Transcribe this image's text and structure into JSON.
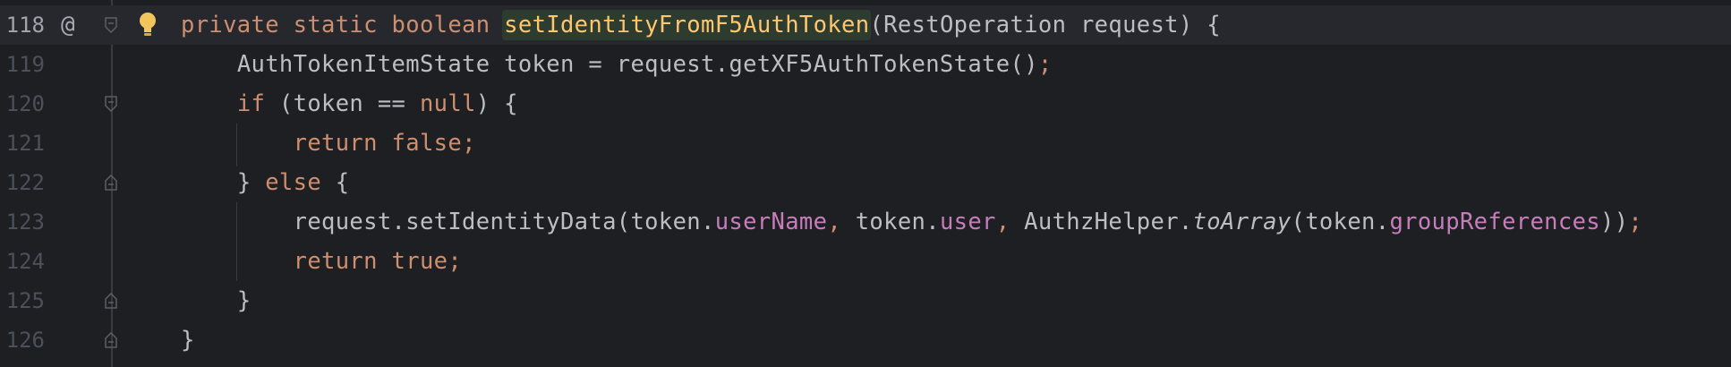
{
  "editor": {
    "gutter": {
      "override_marker": "@",
      "intention_bulb": "lightbulb-icon"
    },
    "lines": [
      {
        "number": "118",
        "indent": "",
        "tokens": [
          {
            "t": "private",
            "c": "kw"
          },
          {
            "t": " "
          },
          {
            "t": "static",
            "c": "kw"
          },
          {
            "t": " "
          },
          {
            "t": "boolean",
            "c": "kw"
          },
          {
            "t": " "
          },
          {
            "t": "setIdentityFromF5AuthToken",
            "c": "fn-decl"
          },
          {
            "t": "(RestOperation request) {"
          }
        ]
      },
      {
        "number": "119",
        "indent": "    ",
        "tokens": [
          {
            "t": "AuthTokenItemState token = request.getXF5AuthTokenState()"
          },
          {
            "t": ";",
            "c": "semi"
          }
        ]
      },
      {
        "number": "120",
        "indent": "    ",
        "tokens": [
          {
            "t": "if",
            "c": "kw"
          },
          {
            "t": " (token == "
          },
          {
            "t": "null",
            "c": "kw"
          },
          {
            "t": ") {"
          }
        ]
      },
      {
        "number": "121",
        "indent": "        ",
        "tokens": [
          {
            "t": "return",
            "c": "kw"
          },
          {
            "t": " "
          },
          {
            "t": "false",
            "c": "kw"
          },
          {
            "t": ";",
            "c": "semi"
          }
        ]
      },
      {
        "number": "122",
        "indent": "    ",
        "tokens": [
          {
            "t": "} "
          },
          {
            "t": "else",
            "c": "kw"
          },
          {
            "t": " {"
          }
        ]
      },
      {
        "number": "123",
        "indent": "        ",
        "tokens": [
          {
            "t": "request.setIdentityData(token."
          },
          {
            "t": "userName",
            "c": "field"
          },
          {
            "t": ",",
            "c": "semi"
          },
          {
            "t": " token."
          },
          {
            "t": "user",
            "c": "field"
          },
          {
            "t": ",",
            "c": "semi"
          },
          {
            "t": " AuthzHelper."
          },
          {
            "t": "toArray",
            "c": "static-call"
          },
          {
            "t": "(token."
          },
          {
            "t": "groupReferences",
            "c": "field"
          },
          {
            "t": "))"
          },
          {
            "t": ";",
            "c": "semi"
          }
        ]
      },
      {
        "number": "124",
        "indent": "        ",
        "tokens": [
          {
            "t": "return",
            "c": "kw"
          },
          {
            "t": " "
          },
          {
            "t": "true",
            "c": "kw"
          },
          {
            "t": ";",
            "c": "semi"
          }
        ]
      },
      {
        "number": "125",
        "indent": "    ",
        "tokens": [
          {
            "t": "}"
          }
        ]
      },
      {
        "number": "126",
        "indent": "",
        "tokens": [
          {
            "t": "}"
          }
        ]
      }
    ],
    "colors": {
      "background": "#1e1f22",
      "keyword": "#cf8e6d",
      "method_declaration": "#ffc66d",
      "field": "#c77dbb",
      "text": "#bcbec4",
      "line_number": "#4b5059"
    }
  }
}
